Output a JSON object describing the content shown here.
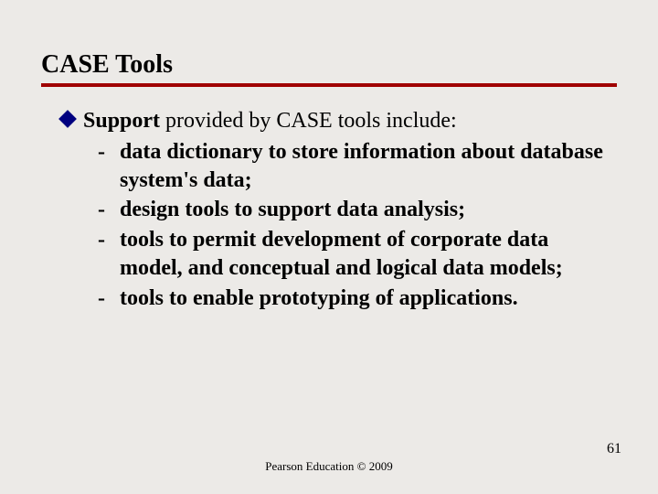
{
  "slide": {
    "title": "CASE Tools",
    "lead_bold": "Support",
    "lead_rest": " provided by CASE tools include:",
    "items": [
      "data dictionary to store information about database system's data;",
      "design tools to support data analysis;",
      "tools to permit development of corporate data model, and conceptual and logical data models;",
      "tools to enable prototyping of applications."
    ],
    "footer": "Pearson Education © 2009",
    "number": "61"
  }
}
